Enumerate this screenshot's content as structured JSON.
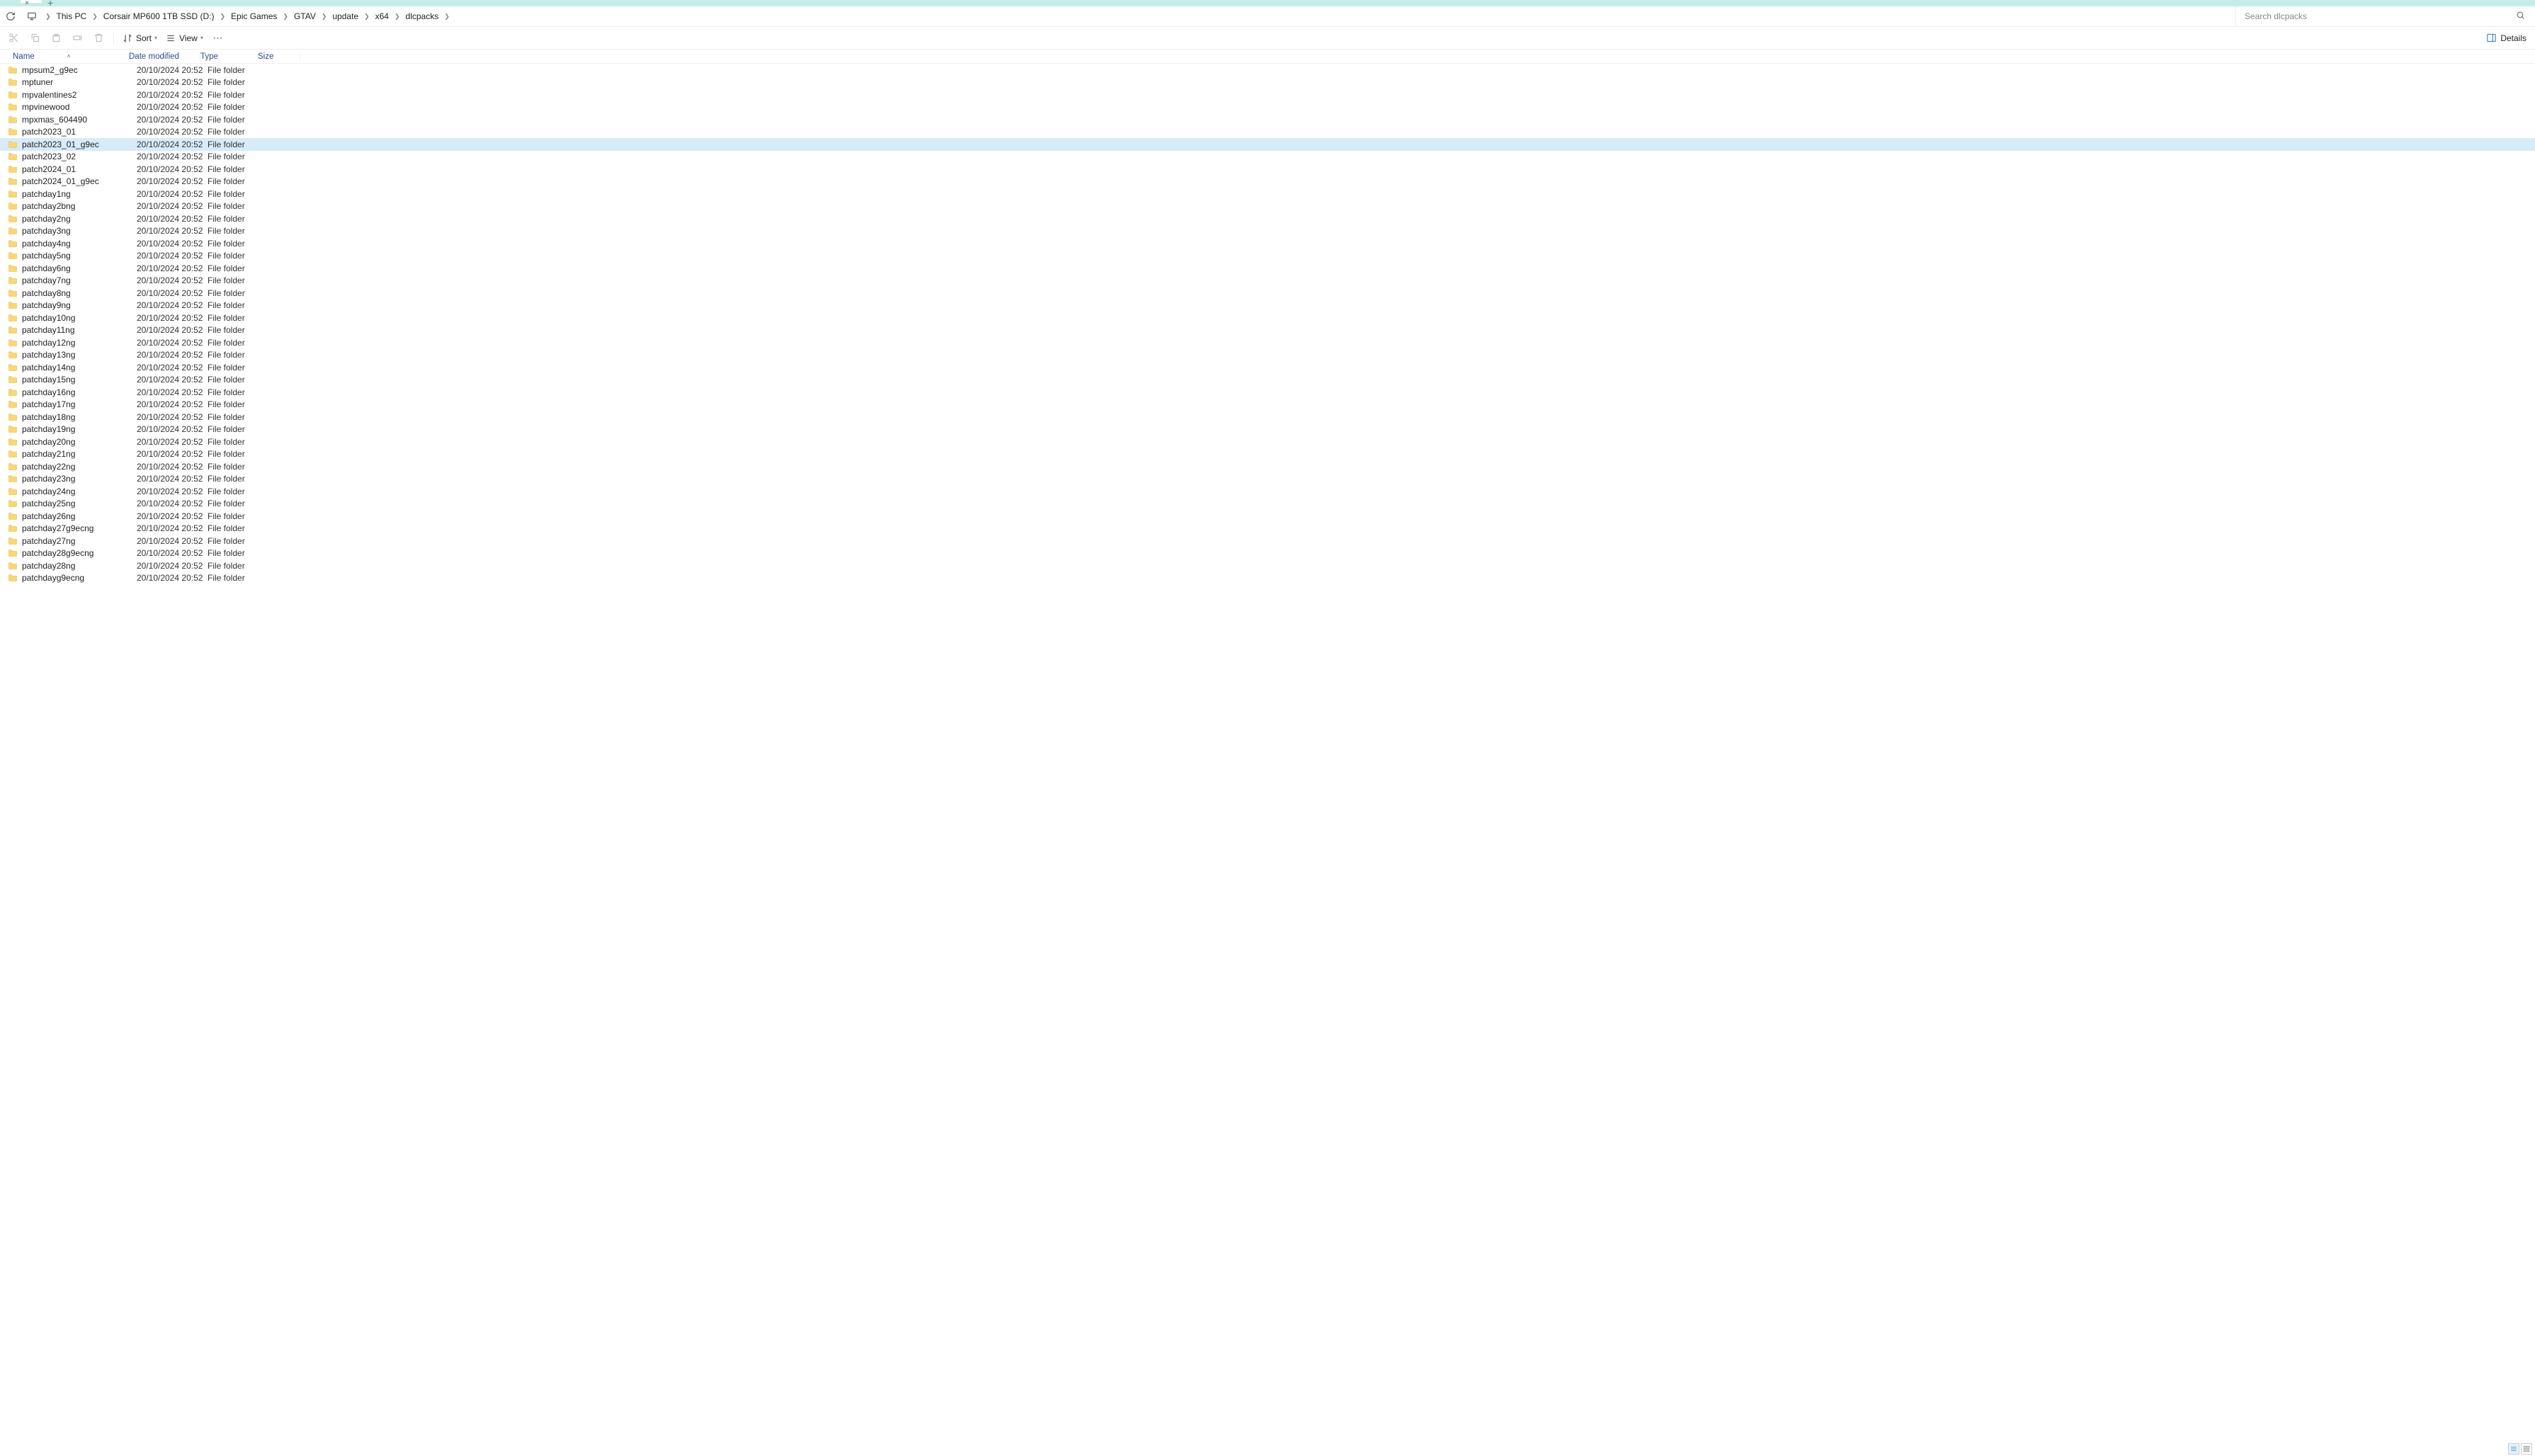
{
  "tab": {
    "close": "×",
    "plus": "+"
  },
  "breadcrumbs": [
    "This PC",
    "Corsair MP600 1TB SSD (D:)",
    "Epic Games",
    "GTAV",
    "update",
    "x64",
    "dlcpacks"
  ],
  "search": {
    "placeholder": "Search dlcpacks"
  },
  "toolbar": {
    "sort_label": "Sort",
    "view_label": "View",
    "details_label": "Details"
  },
  "columns": {
    "name": "Name",
    "date": "Date modified",
    "type": "Type",
    "size": "Size"
  },
  "selected_index": 6,
  "rows": [
    {
      "name": "mpsum2_g9ec",
      "date": "20/10/2024 20:52",
      "type": "File folder"
    },
    {
      "name": "mptuner",
      "date": "20/10/2024 20:52",
      "type": "File folder"
    },
    {
      "name": "mpvalentines2",
      "date": "20/10/2024 20:52",
      "type": "File folder"
    },
    {
      "name": "mpvinewood",
      "date": "20/10/2024 20:52",
      "type": "File folder"
    },
    {
      "name": "mpxmas_604490",
      "date": "20/10/2024 20:52",
      "type": "File folder"
    },
    {
      "name": "patch2023_01",
      "date": "20/10/2024 20:52",
      "type": "File folder"
    },
    {
      "name": "patch2023_01_g9ec",
      "date": "20/10/2024 20:52",
      "type": "File folder"
    },
    {
      "name": "patch2023_02",
      "date": "20/10/2024 20:52",
      "type": "File folder"
    },
    {
      "name": "patch2024_01",
      "date": "20/10/2024 20:52",
      "type": "File folder"
    },
    {
      "name": "patch2024_01_g9ec",
      "date": "20/10/2024 20:52",
      "type": "File folder"
    },
    {
      "name": "patchday1ng",
      "date": "20/10/2024 20:52",
      "type": "File folder"
    },
    {
      "name": "patchday2bng",
      "date": "20/10/2024 20:52",
      "type": "File folder"
    },
    {
      "name": "patchday2ng",
      "date": "20/10/2024 20:52",
      "type": "File folder"
    },
    {
      "name": "patchday3ng",
      "date": "20/10/2024 20:52",
      "type": "File folder"
    },
    {
      "name": "patchday4ng",
      "date": "20/10/2024 20:52",
      "type": "File folder"
    },
    {
      "name": "patchday5ng",
      "date": "20/10/2024 20:52",
      "type": "File folder"
    },
    {
      "name": "patchday6ng",
      "date": "20/10/2024 20:52",
      "type": "File folder"
    },
    {
      "name": "patchday7ng",
      "date": "20/10/2024 20:52",
      "type": "File folder"
    },
    {
      "name": "patchday8ng",
      "date": "20/10/2024 20:52",
      "type": "File folder"
    },
    {
      "name": "patchday9ng",
      "date": "20/10/2024 20:52",
      "type": "File folder"
    },
    {
      "name": "patchday10ng",
      "date": "20/10/2024 20:52",
      "type": "File folder"
    },
    {
      "name": "patchday11ng",
      "date": "20/10/2024 20:52",
      "type": "File folder"
    },
    {
      "name": "patchday12ng",
      "date": "20/10/2024 20:52",
      "type": "File folder"
    },
    {
      "name": "patchday13ng",
      "date": "20/10/2024 20:52",
      "type": "File folder"
    },
    {
      "name": "patchday14ng",
      "date": "20/10/2024 20:52",
      "type": "File folder"
    },
    {
      "name": "patchday15ng",
      "date": "20/10/2024 20:52",
      "type": "File folder"
    },
    {
      "name": "patchday16ng",
      "date": "20/10/2024 20:52",
      "type": "File folder"
    },
    {
      "name": "patchday17ng",
      "date": "20/10/2024 20:52",
      "type": "File folder"
    },
    {
      "name": "patchday18ng",
      "date": "20/10/2024 20:52",
      "type": "File folder"
    },
    {
      "name": "patchday19ng",
      "date": "20/10/2024 20:52",
      "type": "File folder"
    },
    {
      "name": "patchday20ng",
      "date": "20/10/2024 20:52",
      "type": "File folder"
    },
    {
      "name": "patchday21ng",
      "date": "20/10/2024 20:52",
      "type": "File folder"
    },
    {
      "name": "patchday22ng",
      "date": "20/10/2024 20:52",
      "type": "File folder"
    },
    {
      "name": "patchday23ng",
      "date": "20/10/2024 20:52",
      "type": "File folder"
    },
    {
      "name": "patchday24ng",
      "date": "20/10/2024 20:52",
      "type": "File folder"
    },
    {
      "name": "patchday25ng",
      "date": "20/10/2024 20:52",
      "type": "File folder"
    },
    {
      "name": "patchday26ng",
      "date": "20/10/2024 20:52",
      "type": "File folder"
    },
    {
      "name": "patchday27g9ecng",
      "date": "20/10/2024 20:52",
      "type": "File folder"
    },
    {
      "name": "patchday27ng",
      "date": "20/10/2024 20:52",
      "type": "File folder"
    },
    {
      "name": "patchday28g9ecng",
      "date": "20/10/2024 20:52",
      "type": "File folder"
    },
    {
      "name": "patchday28ng",
      "date": "20/10/2024 20:52",
      "type": "File folder"
    },
    {
      "name": "patchdayg9ecng",
      "date": "20/10/2024 20:52",
      "type": "File folder"
    }
  ]
}
